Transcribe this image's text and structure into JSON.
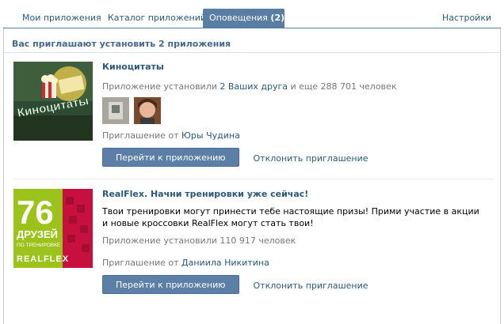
{
  "tabs": [
    {
      "label": "Мои приложения"
    },
    {
      "label": "Каталог приложений"
    },
    {
      "label": "Оповещения",
      "count": "(2)"
    }
  ],
  "settings_label": "Настройки",
  "header": "Вас приглашают установить 2 приложения",
  "apps": [
    {
      "title": "Киноцитаты",
      "installed_prefix": "Приложение установили ",
      "installed_friends": "2 Ваших друга",
      "installed_suffix": " и еще 288 701 человек",
      "thumb_text": "Киноцитаты",
      "invite_prefix": "Приглашение от ",
      "invite_from": "Юры Чудина",
      "go_button": "Перейти к приложению",
      "decline": "Отклонить приглашение"
    },
    {
      "title": "RealFlex. Начни тренировки уже сейчас!",
      "description": "Твои тренировки могут принести тебе настоящие призы! Прими участие в акции и новые кроссовки RealFlex могут стать твои!",
      "installed": "Приложение установили 110 917 человек",
      "thumb_number": "76",
      "thumb_line1": "ДРУЗЕЙ",
      "thumb_line2": "ПО ТРЕНИРОВКЕ",
      "thumb_brand": "REALFLEX",
      "invite_prefix": "Приглашение от ",
      "invite_from": "Даниила Никитина",
      "go_button": "Перейти к приложению",
      "decline": "Отклонить приглашение"
    }
  ],
  "colors": {
    "accent": "#597da3",
    "link": "#2b587a",
    "button": "#5c7fa7",
    "realflex_green": "#9bc31c",
    "realflex_red": "#c8103e"
  }
}
